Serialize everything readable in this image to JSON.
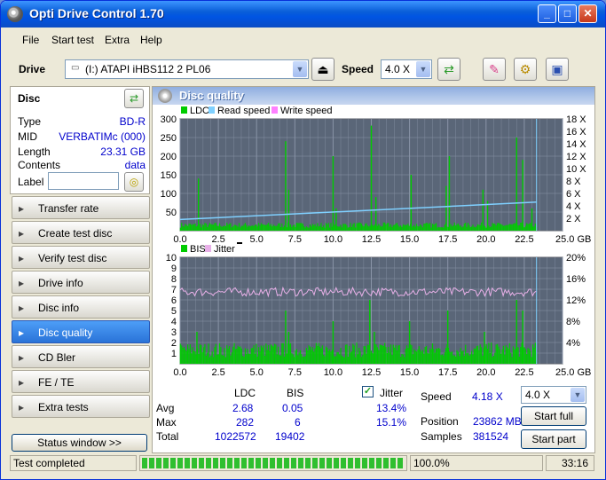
{
  "window": {
    "title": "Opti Drive Control 1.70",
    "minimize": "_",
    "maximize": "□",
    "close": "✕"
  },
  "menu": [
    "File",
    "Start test",
    "Extra",
    "Help"
  ],
  "toolbar": {
    "drive_label": "Drive",
    "drive_value": "(I:)  ATAPI iHBS112  2 PL06",
    "speed_label": "Speed",
    "speed_value": "4.0 X"
  },
  "disc": {
    "header": "Disc",
    "rows": [
      {
        "k": "Type",
        "v": "BD-R"
      },
      {
        "k": "MID",
        "v": "VERBATIMc (000)"
      },
      {
        "k": "Length",
        "v": "23.31 GB"
      },
      {
        "k": "Contents",
        "v": "data"
      }
    ],
    "label_key": "Label",
    "label_value": ""
  },
  "nav": [
    {
      "label": "Transfer rate",
      "icon": "▸"
    },
    {
      "label": "Create test disc",
      "icon": "▸"
    },
    {
      "label": "Verify test disc",
      "icon": "▸"
    },
    {
      "label": "Drive info",
      "icon": "▸"
    },
    {
      "label": "Disc info",
      "icon": "▸"
    },
    {
      "label": "Disc quality",
      "icon": "▸",
      "active": true
    },
    {
      "label": "CD Bler",
      "icon": "▸"
    },
    {
      "label": "FE / TE",
      "icon": "▸"
    },
    {
      "label": "Extra tests",
      "icon": "▸"
    }
  ],
  "status_window_button": "Status window >>",
  "panel_title": "Disc quality",
  "legend_top": {
    "ldc": "LDC",
    "read": "Read speed",
    "write": "Write speed"
  },
  "legend_bottom": {
    "bis": "BIS",
    "jitter": "Jitter"
  },
  "colors": {
    "ldc": "#00cc00",
    "read": "#7fd0ff",
    "write": "#ff80ff",
    "jitter": "#e8b0e8",
    "plot_bg": "#5a6678",
    "grid": "#8a94a8"
  },
  "chart_data": [
    {
      "type": "bar",
      "series": [
        {
          "name": "LDC",
          "values_note": "noisy baseline ~10-20 with spikes"
        },
        {
          "name": "Read speed",
          "x": [
            0,
            23.3
          ],
          "y": [
            1.8,
            4.6
          ]
        }
      ],
      "x_ticks": [
        "0.0",
        "2.5",
        "5.0",
        "7.5",
        "10.0",
        "12.5",
        "15.0",
        "17.5",
        "20.0",
        "22.5",
        "25.0 GB"
      ],
      "y_left_ticks": [
        "300",
        "250",
        "200",
        "150",
        "100",
        "50"
      ],
      "y_right_ticks": [
        "18 X",
        "16 X",
        "14 X",
        "12 X",
        "10 X",
        "8 X",
        "6 X",
        "4 X",
        "2 X"
      ],
      "xlim": [
        0,
        25
      ],
      "ylim": [
        0,
        300
      ],
      "y2lim": [
        0,
        18
      ],
      "spikes": [
        [
          1.2,
          140
        ],
        [
          6.9,
          240
        ],
        [
          7.1,
          110
        ],
        [
          10.0,
          200
        ],
        [
          10.2,
          60
        ],
        [
          12.5,
          282
        ],
        [
          12.8,
          90
        ],
        [
          15.1,
          150
        ],
        [
          17.4,
          120
        ],
        [
          17.6,
          200
        ],
        [
          19.8,
          110
        ],
        [
          20.1,
          80
        ],
        [
          22.0,
          250
        ],
        [
          22.4,
          190
        ],
        [
          23.0,
          60
        ]
      ]
    },
    {
      "type": "bar",
      "series": [
        {
          "name": "BIS",
          "values_note": "baseline ~1-2 with spikes"
        },
        {
          "name": "Jitter",
          "x": [
            0,
            23.3
          ],
          "y": [
            13.4,
            13.4
          ]
        }
      ],
      "x_ticks": [
        "0.0",
        "2.5",
        "5.0",
        "7.5",
        "10.0",
        "12.5",
        "15.0",
        "17.5",
        "20.0",
        "22.5",
        "25.0 GB"
      ],
      "y_left_ticks": [
        "10",
        "9",
        "8",
        "7",
        "6",
        "5",
        "4",
        "3",
        "2",
        "1"
      ],
      "y_right_ticks": [
        "20%",
        "16%",
        "12%",
        "8%",
        "4%"
      ],
      "xlim": [
        0,
        25
      ],
      "ylim": [
        0,
        10
      ],
      "y2lim": [
        0,
        20
      ],
      "spikes": [
        [
          1.1,
          3
        ],
        [
          6.9,
          5
        ],
        [
          7.1,
          3
        ],
        [
          10.0,
          4
        ],
        [
          12.4,
          6
        ],
        [
          12.7,
          3
        ],
        [
          15.0,
          4
        ],
        [
          17.5,
          5
        ],
        [
          19.9,
          3
        ],
        [
          22.0,
          6
        ],
        [
          22.4,
          5
        ]
      ]
    }
  ],
  "stats": {
    "col_ldc": "LDC",
    "col_bis": "BIS",
    "jitter_label": "Jitter",
    "rows": [
      {
        "k": "Avg",
        "ldc": "2.68",
        "bis": "0.05",
        "jit": "13.4%"
      },
      {
        "k": "Max",
        "ldc": "282",
        "bis": "6",
        "jit": "15.1%"
      },
      {
        "k": "Total",
        "ldc": "1022572",
        "bis": "19402",
        "jit": ""
      }
    ],
    "speed_label": "Speed",
    "speed_value": "4.18 X",
    "speed_select": "4.0 X",
    "position_label": "Position",
    "position_value": "23862 MB",
    "samples_label": "Samples",
    "samples_value": "381524",
    "start_full": "Start full",
    "start_part": "Start part"
  },
  "statusbar": {
    "text": "Test completed",
    "percent": "100.0%",
    "time": "33:16",
    "progress": 1.0
  }
}
